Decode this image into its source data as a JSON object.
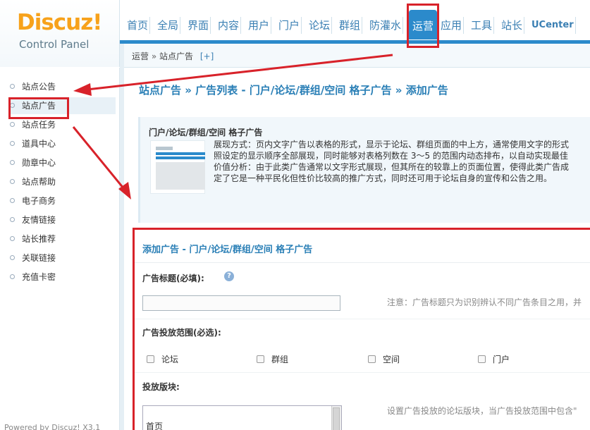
{
  "logo": {
    "main": "Discuz!",
    "sub": "Control Panel"
  },
  "nav": {
    "items": [
      "首页",
      "全局",
      "界面",
      "内容",
      "用户",
      "门户",
      "论坛",
      "群组",
      "防灌水",
      "运营",
      "应用",
      "工具",
      "站长",
      "UCenter"
    ],
    "active": "运营"
  },
  "breadcrumb": {
    "section": "运营",
    "separator": "»",
    "page": "站点广告",
    "add": "[+]"
  },
  "sidebar": {
    "items": [
      "站点公告",
      "站点广告",
      "站点任务",
      "道具中心",
      "勋章中心",
      "站点帮助",
      "电子商务",
      "友情链接",
      "站长推荐",
      "关联链接",
      "充值卡密"
    ],
    "active": "站点广告"
  },
  "powered": "Powered by Discuz! X3.1",
  "main": {
    "title_parts": [
      "站点广告",
      "广告列表 - 门户/论坛/群组/空间 格子广告",
      "添加广告"
    ],
    "title_sep": "»",
    "info": {
      "title": "门户/论坛/群组/空间 格子广告",
      "lines": [
        "展现方式：页内文字广告以表格的形式，显示于论坛、群组页面的中上方，通常使用文字的形式",
        "照设定的显示顺序全部展现，同时能够对表格列数在 3～5 的范围内动态排布，以自动实现最佳",
        "价值分析：由于此类广告通常以文字形式展现，但其所在的较靠上的页面位置，使得此类广告成",
        "定了它是一种平民化但性价比较高的推广方式，同时还可用于论坛自身的宣传和公告之用。"
      ]
    },
    "form": {
      "title": "添加广告 - 门户/论坛/群组/空间 格子广告",
      "ad_title_label": "广告标题(必填):",
      "ad_title_value": "",
      "ad_title_note": "注意：广告标题只为识别辨认不同广告条目之用，并",
      "scope_label": "广告投放范围(必选):",
      "scope_options": [
        "论坛",
        "群组",
        "空间",
        "门户"
      ],
      "block_label": "投放版块:",
      "block_note": "设置广告投放的论坛版块，当广告投放范围中包含\"",
      "block_options": [
        "首页"
      ]
    }
  },
  "colors": {
    "accent": "#2b8acb",
    "annotation": "#d8222a",
    "logo": "#f7a21b"
  }
}
